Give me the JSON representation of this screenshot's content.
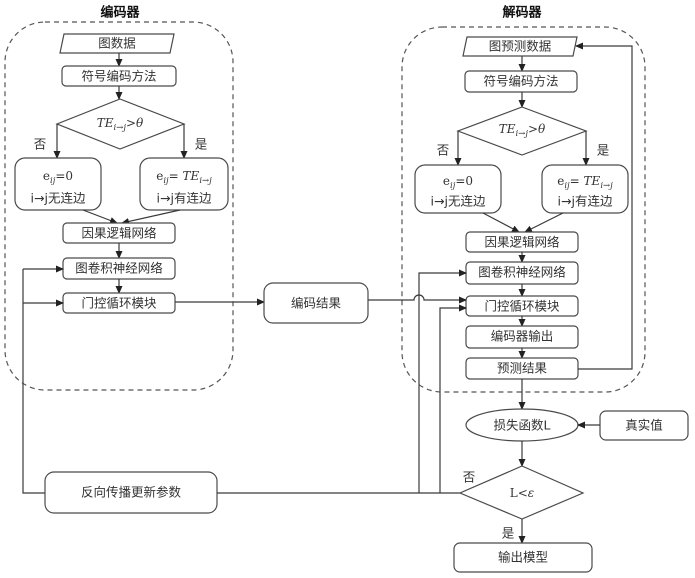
{
  "encoder": {
    "title": "编码器",
    "input": "图数据",
    "sign_encoding": "符号编码方法",
    "condition": {
      "base": "TE",
      "sub": "i→j",
      "rest": ">θ"
    },
    "no_label": "否",
    "yes_label": "是",
    "no_box": {
      "e": "e",
      "e_sub": "ij",
      "rest": "=0",
      "line2": "i→j无连边"
    },
    "yes_box": {
      "e": "e",
      "e_sub": "ij",
      "eq": "= ",
      "te": "TE",
      "te_sub": "i→j",
      "line2": "i→j有连边"
    },
    "causal_network": "因果逻辑网络",
    "gcn": "图卷积神经网络",
    "gru": "门控循环模块"
  },
  "encoding_result": "编码结果",
  "decoder": {
    "title": "解码器",
    "input": "图预测数据",
    "sign_encoding": "符号编码方法",
    "condition": {
      "base": "TE",
      "sub": "i→j",
      "rest": ">θ"
    },
    "no_label": "否",
    "yes_label": "是",
    "no_box": {
      "e": "e",
      "e_sub": "ij",
      "rest": "=0",
      "line2": "i→j无连边"
    },
    "yes_box": {
      "e": "e",
      "e_sub": "ij",
      "eq": "= ",
      "te": "TE",
      "te_sub": "i→j",
      "line2": "i→j有连边"
    },
    "causal_network": "因果逻辑网络",
    "gcn": "图卷积神经网络",
    "gru": "门控循环模块",
    "decoder_output": "编码器输出",
    "prediction": "预测结果"
  },
  "loss_function": "损失函数L",
  "ground_truth": "真实值",
  "convergence_check": {
    "lhs": "L<",
    "eps": "ε",
    "no_label": "否",
    "yes_label": "是"
  },
  "output_model": "输出模型",
  "backprop": "反向传播更新参数"
}
